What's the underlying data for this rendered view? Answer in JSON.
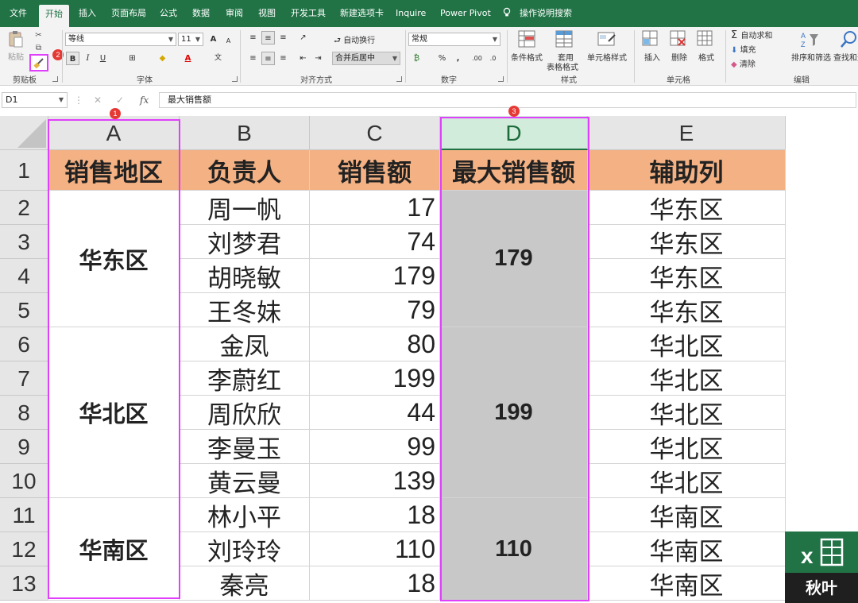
{
  "menu": {
    "tabs": [
      "文件",
      "开始",
      "插入",
      "页面布局",
      "公式",
      "数据",
      "审阅",
      "视图",
      "开发工具",
      "新建选项卡",
      "Inquire",
      "Power Pivot",
      "操作说明搜索"
    ],
    "active": "开始"
  },
  "ribbon": {
    "clipboard": {
      "paste": "粘贴",
      "group": "剪贴板"
    },
    "font": {
      "name": "等线",
      "size": "11",
      "group": "字体",
      "bold": "B",
      "italic": "I",
      "underline": "U",
      "grow": "A",
      "shrink": "A"
    },
    "alignment": {
      "wrap": "自动换行",
      "merge": "合并后居中",
      "group": "对齐方式"
    },
    "number": {
      "format": "常规",
      "group": "数字",
      "percent": "%",
      "comma": ","
    },
    "styles": {
      "cond": "条件格式",
      "table_a": "套用",
      "table_b": "表格格式",
      "cell": "单元格样式",
      "group": "样式"
    },
    "cells": {
      "insert": "插入",
      "delete": "删除",
      "format": "格式",
      "group": "单元格"
    },
    "editing": {
      "autosum": "自动求和",
      "fill": "填充",
      "clear": "清除",
      "sort": "排序和筛选",
      "find": "查找和选",
      "group": "编辑"
    }
  },
  "formula_bar": {
    "name_box": "D1",
    "fx": "fx",
    "content": "最大销售额"
  },
  "columns": [
    "A",
    "B",
    "C",
    "D",
    "E"
  ],
  "rows": [
    "1",
    "2",
    "3",
    "4",
    "5",
    "6",
    "7",
    "8",
    "9",
    "10",
    "11",
    "12",
    "13"
  ],
  "header": [
    "销售地区",
    "负责人",
    "销售额",
    "最大销售额",
    "辅助列"
  ],
  "data": [
    {
      "person": "周一帆",
      "sales": "17",
      "helper": "华东区"
    },
    {
      "person": "刘梦君",
      "sales": "74",
      "helper": "华东区"
    },
    {
      "person": "胡晓敏",
      "sales": "179",
      "helper": "华东区"
    },
    {
      "person": "王冬妹",
      "sales": "79",
      "helper": "华东区"
    },
    {
      "person": "金凤",
      "sales": "80",
      "helper": "华北区"
    },
    {
      "person": "李蔚红",
      "sales": "199",
      "helper": "华北区"
    },
    {
      "person": "周欣欣",
      "sales": "44",
      "helper": "华北区"
    },
    {
      "person": "李曼玉",
      "sales": "99",
      "helper": "华北区"
    },
    {
      "person": "黄云曼",
      "sales": "139",
      "helper": "华北区"
    },
    {
      "person": "林小平",
      "sales": "18",
      "helper": "华南区"
    },
    {
      "person": "刘玲玲",
      "sales": "110",
      "helper": "华南区"
    },
    {
      "person": "秦亮",
      "sales": "18",
      "helper": "华南区"
    }
  ],
  "regions": [
    {
      "name": "华东区",
      "max": "179"
    },
    {
      "name": "华北区",
      "max": "199"
    },
    {
      "name": "华南区",
      "max": "110"
    }
  ],
  "badges": [
    "1",
    "2",
    "3"
  ],
  "watermark": "秋叶"
}
